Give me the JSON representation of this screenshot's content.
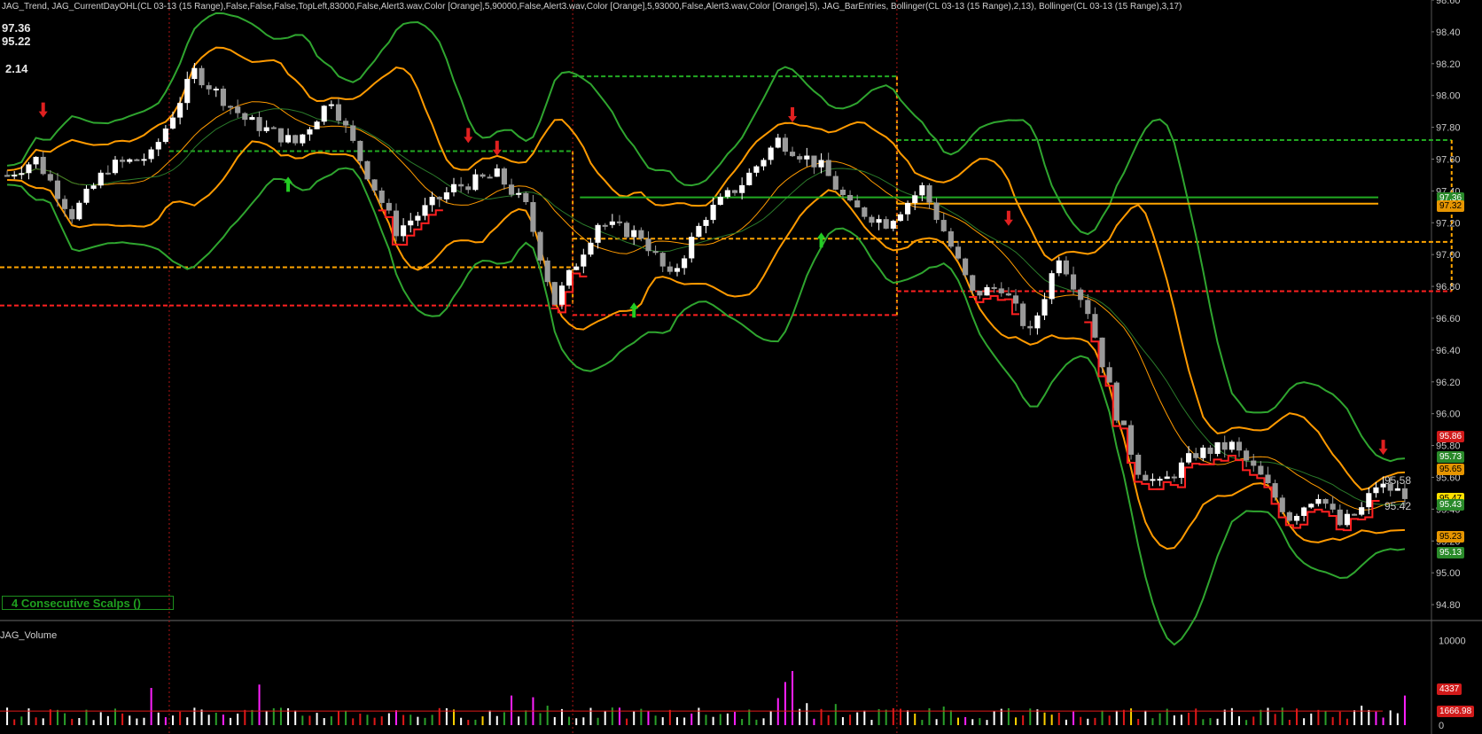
{
  "header": {
    "indicators": "JAG_Trend, JAG_CurrentDayOHL(CL 03-13 (15 Range),False,False,False,TopLeft,83000,False,Alert3.wav,Color [Orange],5,90000,False,Alert3.wav,Color [Orange],5,93000,False,Alert3.wav,Color [Orange],5), JAG_BarEntries, Bollinger(CL 03-13 (15 Range),2,13), Bollinger(CL 03-13 (15 Range),3,17)"
  },
  "ohl": {
    "high": "97.36",
    "low": "95.22",
    "range": "2.14"
  },
  "scalps_box": "4  Consecutive Scalps ()",
  "volume_panel": {
    "title": "JAG_Volume"
  },
  "colors": {
    "background": "#000000",
    "bull_candle": "#ffffff",
    "bear_candle": "#9a9a9a",
    "inner_band": "#ff9a00",
    "outer_band": "#2fa52f",
    "level_red": "#ff2020",
    "level_orange": "#ffa500",
    "level_green": "#22aa22",
    "session_line": "#b01515"
  },
  "chart_data": {
    "type": "candlestick",
    "instrument": "CL 03-13 (15 Range)",
    "price_axis": {
      "ylim": [
        94.7,
        98.6
      ],
      "ticks": [
        "98.60",
        "98.40",
        "98.20",
        "98.00",
        "97.80",
        "97.60",
        "97.40",
        "97.20",
        "97.00",
        "96.80",
        "96.60",
        "96.40",
        "96.20",
        "96.00",
        "95.80",
        "95.60",
        "95.40",
        "95.20",
        "95.00",
        "94.80"
      ]
    },
    "price_path": [
      [
        0,
        97.5
      ],
      [
        4,
        97.6
      ],
      [
        9,
        97.25
      ],
      [
        14,
        97.55
      ],
      [
        20,
        97.62
      ],
      [
        26,
        98.15
      ],
      [
        33,
        97.85
      ],
      [
        40,
        97.7
      ],
      [
        45,
        97.98
      ],
      [
        49,
        97.6
      ],
      [
        54,
        97.15
      ],
      [
        62,
        97.42
      ],
      [
        68,
        97.5
      ],
      [
        72,
        97.3
      ],
      [
        76,
        96.7
      ],
      [
        82,
        97.2
      ],
      [
        88,
        97.12
      ],
      [
        92,
        96.85
      ],
      [
        97,
        97.25
      ],
      [
        102,
        97.45
      ],
      [
        107,
        97.72
      ],
      [
        113,
        97.55
      ],
      [
        117,
        97.3
      ],
      [
        122,
        97.2
      ],
      [
        127,
        97.42
      ],
      [
        130,
        97.15
      ],
      [
        134,
        96.75
      ],
      [
        138,
        96.8
      ],
      [
        142,
        96.5
      ],
      [
        146,
        97.0
      ],
      [
        150,
        96.65
      ],
      [
        154,
        96.0
      ],
      [
        157,
        95.65
      ],
      [
        160,
        95.55
      ],
      [
        165,
        95.75
      ],
      [
        170,
        95.8
      ],
      [
        174,
        95.6
      ],
      [
        178,
        95.35
      ],
      [
        182,
        95.5
      ],
      [
        185,
        95.3
      ],
      [
        188,
        95.4
      ],
      [
        190,
        95.55
      ],
      [
        194,
        95.5
      ]
    ],
    "bars": 195,
    "bollinger_2_13": {
      "upper_offset": 0.18,
      "lower_offset": 0.18
    },
    "bollinger_3_17": {
      "upper_offset": 0.35,
      "lower_offset": 0.35
    },
    "horizontal_levels": [
      {
        "value": 97.36,
        "color": "green",
        "from_bar": 80,
        "label": "97.36"
      },
      {
        "value": 97.32,
        "color": "orange",
        "from_bar": 124,
        "label": "97.32"
      }
    ],
    "sessions": [
      {
        "x_bar": 23,
        "high": 97.65,
        "low": 96.92,
        "open_red": 96.68
      },
      {
        "x_bar": 79,
        "high": 98.12,
        "low": 97.1,
        "open_red": 96.62
      },
      {
        "x_bar": 124,
        "high": 97.72,
        "low": 97.08,
        "open_red": 96.77
      }
    ],
    "arrows": [
      {
        "bar": 5,
        "direction": "down",
        "color": "red",
        "price": 97.9
      },
      {
        "bar": 39,
        "direction": "up",
        "color": "green",
        "price": 97.45
      },
      {
        "bar": 64,
        "direction": "down",
        "color": "red",
        "price": 97.74
      },
      {
        "bar": 68,
        "direction": "down",
        "color": "red",
        "price": 97.66
      },
      {
        "bar": 87,
        "direction": "up",
        "color": "green",
        "price": 96.66
      },
      {
        "bar": 109,
        "direction": "down",
        "color": "red",
        "price": 97.87
      },
      {
        "bar": 113,
        "direction": "up",
        "color": "green",
        "price": 97.1
      },
      {
        "bar": 139,
        "direction": "down",
        "color": "red",
        "price": 97.22
      },
      {
        "bar": 191,
        "direction": "down",
        "color": "red",
        "price": 95.78
      }
    ],
    "right_tags": [
      {
        "label": "97.36",
        "price": 97.36,
        "bg": "#2a8a2a",
        "fg": "#fff"
      },
      {
        "label": "97.32",
        "price": 97.31,
        "bg": "#e69500",
        "fg": "#000"
      },
      {
        "label": "95.86",
        "price": 95.86,
        "bg": "#d01a1a",
        "fg": "#fff"
      },
      {
        "label": "95.73",
        "price": 95.73,
        "bg": "#2a8a2a",
        "fg": "#fff"
      },
      {
        "label": "95.65",
        "price": 95.65,
        "bg": "#e69500",
        "fg": "#000"
      },
      {
        "label": "95.47",
        "price": 95.47,
        "bg": "#ffe000",
        "fg": "#000"
      },
      {
        "label": "95.43",
        "price": 95.43,
        "bg": "#2a8a2a",
        "fg": "#fff"
      },
      {
        "label": "95.23",
        "price": 95.23,
        "bg": "#e69500",
        "fg": "#000"
      },
      {
        "label": "95.13",
        "price": 95.13,
        "bg": "#2a8a2a",
        "fg": "#fff"
      }
    ],
    "last_bar_labels": [
      {
        "label": "95.58",
        "price": 95.58
      },
      {
        "label": "95.42",
        "price": 95.42
      }
    ],
    "volume": {
      "ylim": [
        0,
        10800
      ],
      "ticks": [
        "10000",
        "0"
      ],
      "tags": [
        {
          "label": "4337",
          "value": 4337,
          "bg": "#d01a1a"
        },
        {
          "label": "1666.98",
          "value": 1666.98,
          "bg": "#d01a1a"
        }
      ],
      "average": 1667,
      "spikes": [
        [
          35,
          4800
        ],
        [
          20,
          4400
        ],
        [
          70,
          3500
        ],
        [
          73,
          3300
        ],
        [
          75,
          2300
        ],
        [
          77,
          1900
        ],
        [
          92,
          1800
        ],
        [
          107,
          3200
        ],
        [
          108,
          5100
        ],
        [
          109,
          6400
        ],
        [
          111,
          2600
        ],
        [
          115,
          2500
        ],
        [
          130,
          2200
        ],
        [
          139,
          2000
        ],
        [
          148,
          1600
        ],
        [
          182,
          1800
        ],
        [
          188,
          2300
        ],
        [
          190,
          1600
        ],
        [
          194,
          3500
        ]
      ]
    }
  }
}
